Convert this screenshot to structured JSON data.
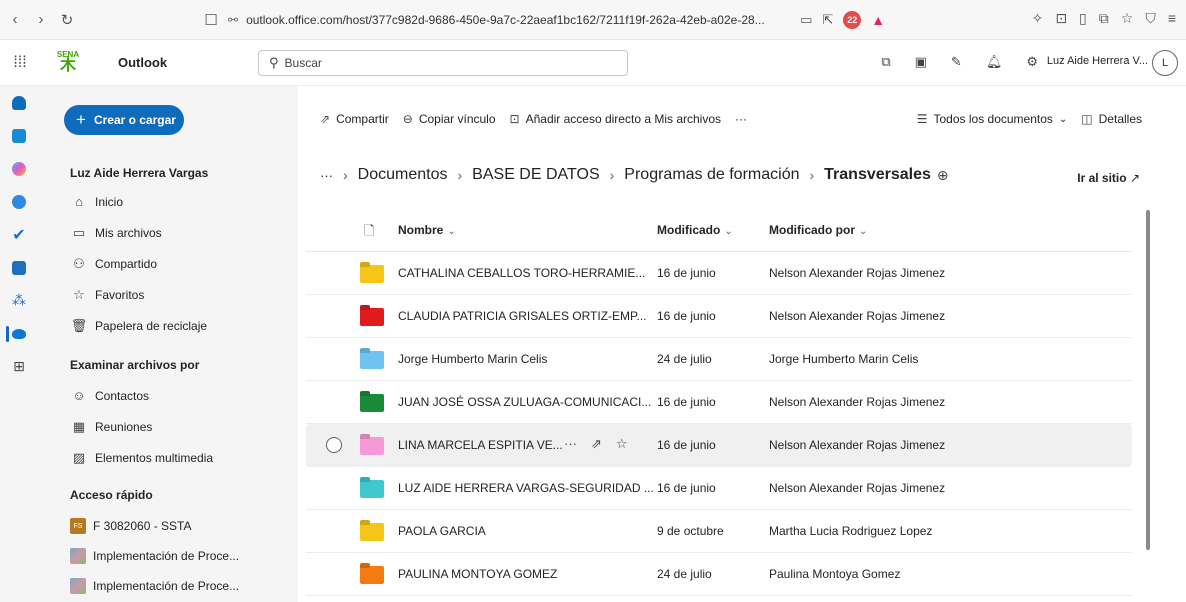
{
  "browser": {
    "url": "outlook.office.com/host/377c982d-9686-450e-9a7c-22aeaf1bc162/7211f19f-262a-42eb-a02e-28...",
    "ext_badge": "22"
  },
  "header": {
    "app_title": "Outlook",
    "logo_text": "SENA",
    "search_placeholder": "Buscar",
    "user_name": "Luz Aide Herrera V...",
    "avatar_initial": "L"
  },
  "nav": {
    "create_label": "Crear o cargar",
    "owner": "Luz Aide Herrera Vargas",
    "items": [
      {
        "label": "Inicio",
        "icon": "home-icon"
      },
      {
        "label": "Mis archivos",
        "icon": "folder-icon"
      },
      {
        "label": "Compartido",
        "icon": "people-icon"
      },
      {
        "label": "Favoritos",
        "icon": "star-icon"
      },
      {
        "label": "Papelera de reciclaje",
        "icon": "trash-icon"
      }
    ],
    "browse_title": "Examinar archivos por",
    "browse_items": [
      {
        "label": "Contactos",
        "icon": "person-icon"
      },
      {
        "label": "Reuniones",
        "icon": "calendar-icon"
      },
      {
        "label": "Elementos multimedia",
        "icon": "image-icon"
      }
    ],
    "quick_title": "Acceso rápido",
    "quick_items": [
      {
        "label": "F 3082060 - SSTA",
        "badge": "FS"
      },
      {
        "label": "Implementación de Proce..."
      },
      {
        "label": "Implementación de Proce..."
      }
    ]
  },
  "commands": {
    "share": "Compartir",
    "copy_link": "Copiar vínculo",
    "add_shortcut": "Añadir acceso directo a Mis archivos",
    "more": "···",
    "view": "Todos los documentos",
    "details": "Detalles"
  },
  "breadcrumb": {
    "ellipsis": "···",
    "items": [
      "Documentos",
      "BASE DE DATOS",
      "Programas de formación"
    ],
    "current": "Transversales",
    "go_site": "Ir al sitio"
  },
  "table": {
    "headers": {
      "name": "Nombre",
      "modified": "Modificado",
      "modified_by": "Modificado por"
    },
    "rows": [
      {
        "name": "CATHALINA CEBALLOS TORO-HERRAMIE...",
        "modified": "16 de junio",
        "modified_by": "Nelson Alexander Rojas Jimenez",
        "color": "#f5c518"
      },
      {
        "name": "CLAUDIA PATRICIA GRISALES ORTIZ-EMP...",
        "modified": "16 de junio",
        "modified_by": "Nelson Alexander Rojas Jimenez",
        "color": "#e01b1b"
      },
      {
        "name": "Jorge Humberto Marin Celis",
        "modified": "24 de julio",
        "modified_by": "Jorge Humberto Marin Celis",
        "color": "#6ec3f0"
      },
      {
        "name": "JUAN JOSÉ OSSA ZULUAGA-COMUNICACI...",
        "modified": "16 de junio",
        "modified_by": "Nelson Alexander Rojas Jimenez",
        "color": "#1a8a3a"
      },
      {
        "name": "LINA MARCELA ESPITIA VE...",
        "modified": "16 de junio",
        "modified_by": "Nelson Alexander Rojas Jimenez",
        "color": "#f59ad6"
      },
      {
        "name": "LUZ AIDE HERRERA VARGAS-SEGURIDAD ...",
        "modified": "16 de junio",
        "modified_by": "Nelson Alexander Rojas Jimenez",
        "color": "#3fc9cf"
      },
      {
        "name": "PAOLA GARCIA",
        "modified": "9 de octubre",
        "modified_by": "Martha Lucia Rodriguez Lopez",
        "color": "#f5c518"
      },
      {
        "name": "PAULINA MONTOYA GOMEZ",
        "modified": "24 de julio",
        "modified_by": "Paulina Montoya Gomez",
        "color": "#f47a12"
      }
    ]
  }
}
